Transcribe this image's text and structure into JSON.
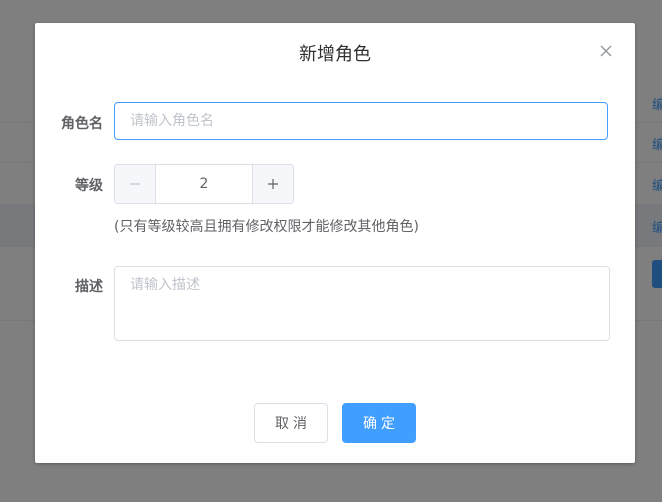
{
  "background": {
    "row_links": [
      "编",
      "编",
      "编",
      "编"
    ]
  },
  "dialog": {
    "title": "新增角色",
    "close_icon": "close-icon",
    "name_field": {
      "label": "角色名",
      "value": "",
      "placeholder": "请输入角色名"
    },
    "level_field": {
      "label": "等级",
      "value": "2",
      "minus_icon": "minus-icon",
      "plus_icon": "plus-icon",
      "hint": "(只有等级较高且拥有修改权限才能修改其他角色)"
    },
    "description_field": {
      "label": "描述",
      "value": "",
      "placeholder": "请输入描述"
    },
    "buttons": {
      "cancel": "取消",
      "confirm": "确定"
    }
  },
  "colors": {
    "primary": "#409eff",
    "text": "#606266",
    "placeholder": "#c0c4cc",
    "border": "#dcdfe6"
  }
}
